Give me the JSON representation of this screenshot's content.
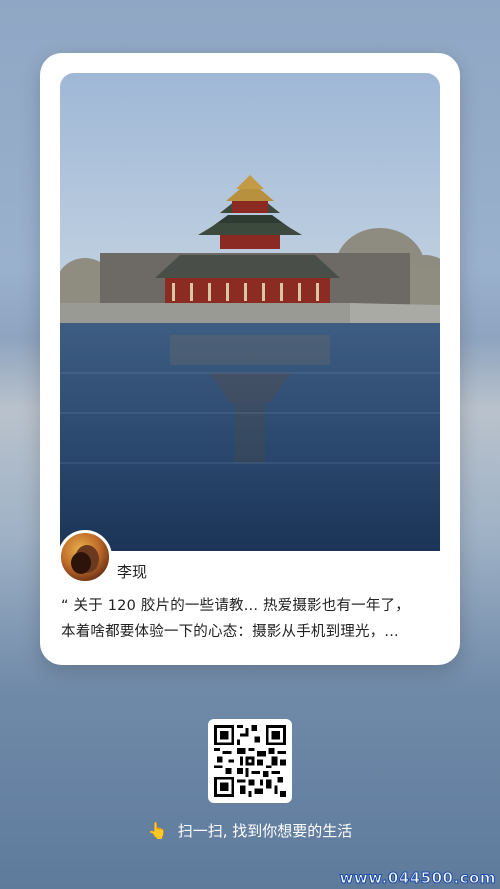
{
  "post": {
    "author": "李现",
    "excerpt_line1": "“ 关于 120 胶片的一些请教... 热爱摄影也有一年了，",
    "excerpt_line2": "本着啥都要体验一下的心态：摄影从手机到理光，..."
  },
  "share": {
    "prompt": "扫一扫, 找到你想要的生活",
    "prompt_icon": "pointing-hand-icon",
    "hand_glyph": "👆"
  },
  "watermark": "www.044500.com"
}
